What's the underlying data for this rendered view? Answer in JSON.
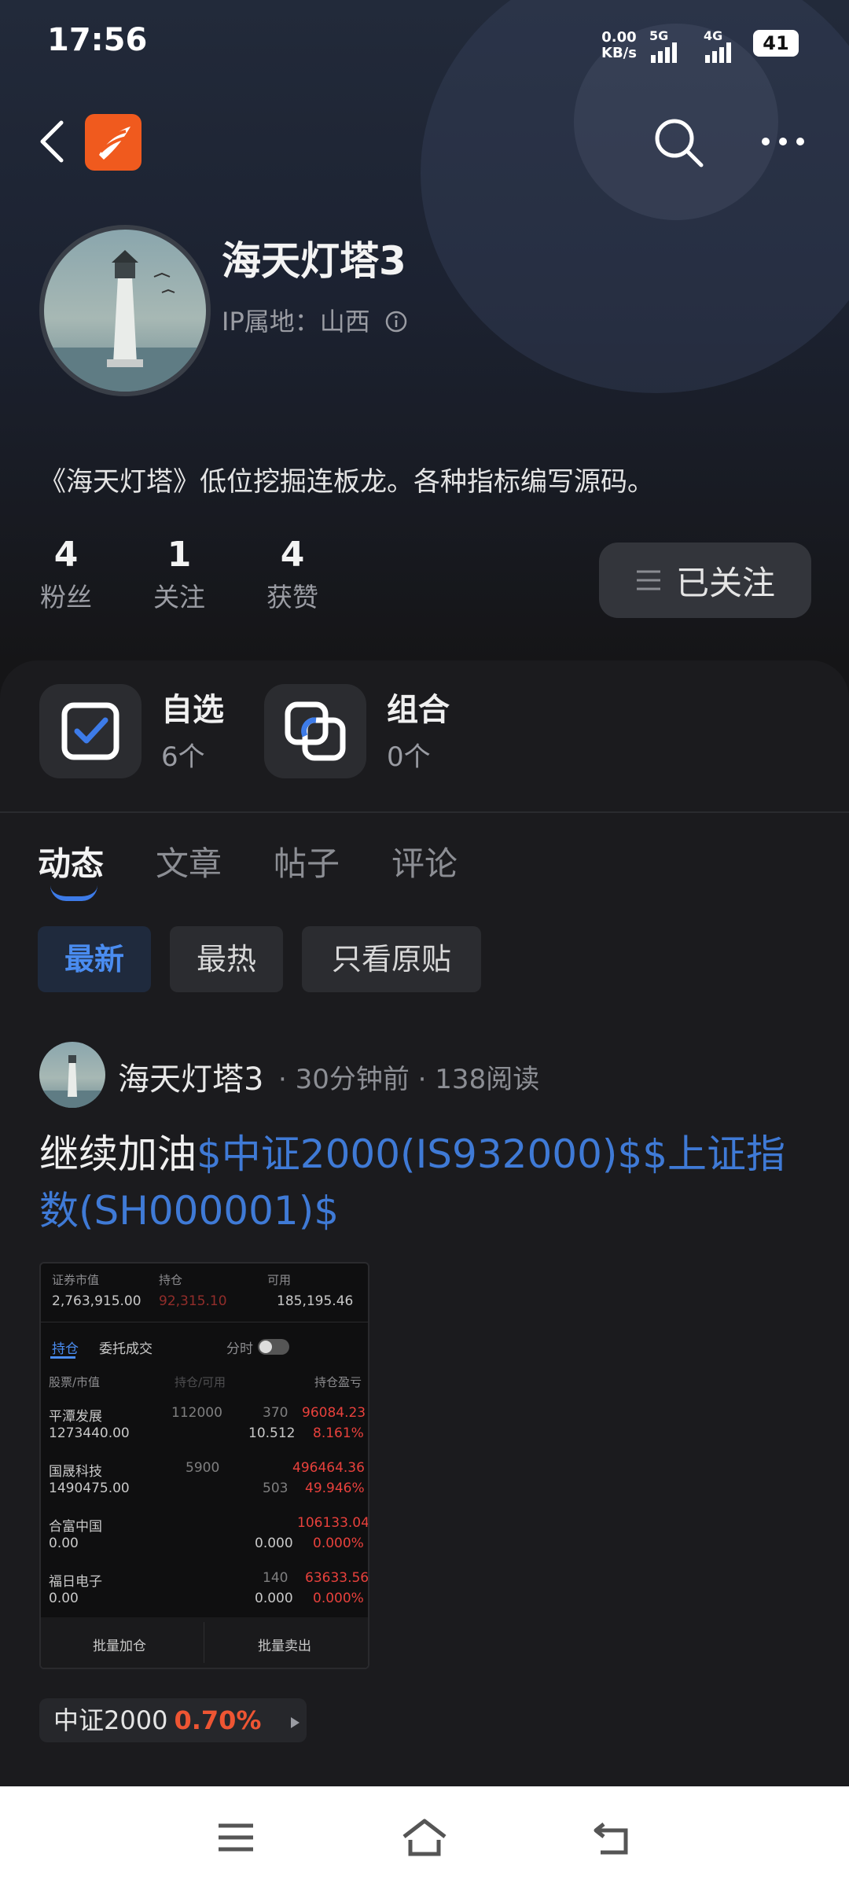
{
  "status_bar": {
    "time": "17:56",
    "net_speed": "0.00",
    "net_unit": "KB/s",
    "sig1": "5G",
    "sig2": "4G",
    "battery": "41"
  },
  "profile": {
    "name": "海天灯塔3",
    "ip_location": "IP属地：山西",
    "bio": "《海天灯塔》低位挖掘连板龙。各种指标编写源码。",
    "stats": [
      {
        "count": "4",
        "label": "粉丝"
      },
      {
        "count": "1",
        "label": "关注"
      },
      {
        "count": "4",
        "label": "获赞"
      }
    ],
    "follow_label": "已关注"
  },
  "collections": [
    {
      "title": "自选",
      "sub": "6个",
      "icon": "checkbox-icon"
    },
    {
      "title": "组合",
      "sub": "0个",
      "icon": "overlap-squares-icon"
    }
  ],
  "tabs": [
    "动态",
    "文章",
    "帖子",
    "评论"
  ],
  "filters": [
    "最新",
    "最热",
    "只看原贴"
  ],
  "post": {
    "author": "海天灯塔3",
    "meta": "· 30分钟前 · 138阅读",
    "text_plain": "继续加油",
    "text_link": "$中证2000(IS932000)$$上证指数(SH000001)$",
    "index_name": "中证2000",
    "index_change": "0.70%"
  },
  "screenshot": {
    "h1": "证券市值",
    "h2": "持仓",
    "h3": "可用",
    "v1": "2,763,915.00",
    "v2": "92,315.10",
    "v3": "185,195.46",
    "tab1": "持仓",
    "tab2": "委托成交",
    "toggle": "分时",
    "col1": "股票/市值",
    "col2": "持仓/可用",
    "col3": "持仓盈亏",
    "rows": [
      {
        "name": "平潭发展",
        "value": "1273440.00",
        "qty": "112000",
        "cost": "370",
        "price": "10.512",
        "pl": "96084.23",
        "pct": "8.161%"
      },
      {
        "name": "国晟科技",
        "value": "1490475.00",
        "qty": "5900",
        "cost": "",
        "price": "503",
        "pl": "496464.36",
        "pct": "49.946%"
      },
      {
        "name": "合富中国",
        "value": "0.00",
        "qty": "",
        "cost": "",
        "price": "0.000",
        "pl": "106133.04",
        "pct": "0.000%"
      },
      {
        "name": "福日电子",
        "value": "0.00",
        "qty": "",
        "cost": "140",
        "price": "0.000",
        "pl": "63633.56",
        "pct": "0.000%"
      }
    ],
    "btn_add": "批量加仓",
    "btn_sell": "批量卖出"
  }
}
